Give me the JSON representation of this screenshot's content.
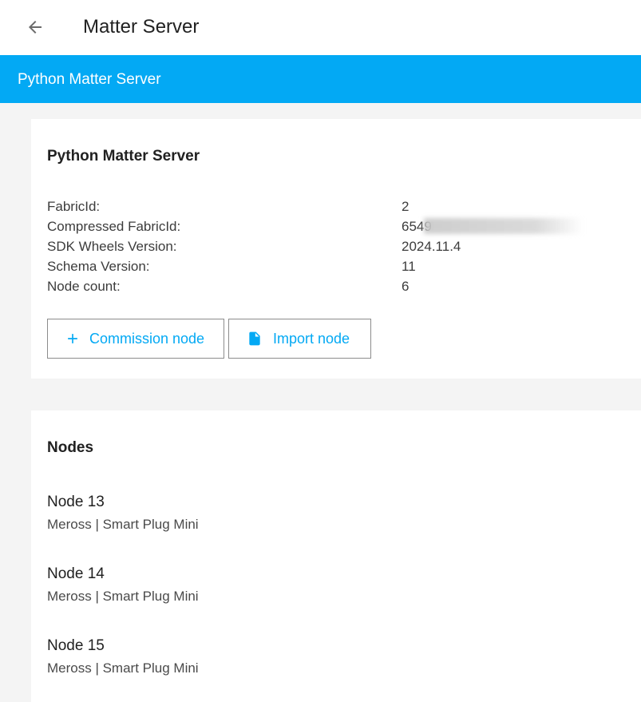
{
  "header": {
    "title": "Matter Server",
    "back_icon": "arrow-left-icon"
  },
  "toolbar": {
    "title": "Python Matter Server",
    "color": "#03a9f4"
  },
  "server_card": {
    "title": "Python Matter Server",
    "info": [
      {
        "label": "FabricId:",
        "value": "2"
      },
      {
        "label": "Compressed FabricId:",
        "value": "6549"
      },
      {
        "label": "SDK Wheels Version:",
        "value": "2024.11.4"
      },
      {
        "label": "Schema Version:",
        "value": "11"
      },
      {
        "label": "Node count:",
        "value": "6"
      }
    ],
    "buttons": {
      "commission_label": "Commission node",
      "commission_icon": "plus-icon",
      "import_label": "Import node",
      "import_icon": "file-icon"
    }
  },
  "nodes_card": {
    "title": "Nodes",
    "nodes": [
      {
        "name": "Node 13",
        "description": "Meross | Smart Plug Mini"
      },
      {
        "name": "Node 14",
        "description": "Meross | Smart Plug Mini"
      },
      {
        "name": "Node 15",
        "description": "Meross | Smart Plug Mini"
      }
    ]
  }
}
